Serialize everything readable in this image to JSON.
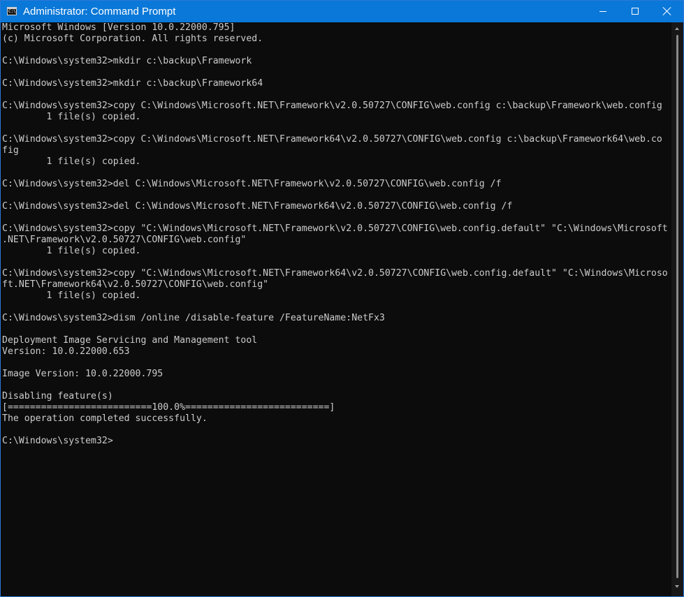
{
  "window": {
    "title": "Administrator: Command Prompt",
    "icon": "cmd-icon",
    "icon_prompt": "C:\\",
    "controls": [
      "minimize-icon",
      "maximize-icon",
      "close-icon"
    ]
  },
  "colors": {
    "titlebar": "#0a78d8",
    "console_bg": "#0c0c0c",
    "console_text": "#cccccc"
  },
  "console": {
    "lines": [
      "Microsoft Windows [Version 10.0.22000.795]",
      "(c) Microsoft Corporation. All rights reserved.",
      "",
      "C:\\Windows\\system32>mkdir c:\\backup\\Framework",
      "",
      "C:\\Windows\\system32>mkdir c:\\backup\\Framework64",
      "",
      "C:\\Windows\\system32>copy C:\\Windows\\Microsoft.NET\\Framework\\v2.0.50727\\CONFIG\\web.config c:\\backup\\Framework\\web.config",
      "        1 file(s) copied.",
      "",
      "C:\\Windows\\system32>copy C:\\Windows\\Microsoft.NET\\Framework64\\v2.0.50727\\CONFIG\\web.config c:\\backup\\Framework64\\web.co",
      "fig",
      "        1 file(s) copied.",
      "",
      "C:\\Windows\\system32>del C:\\Windows\\Microsoft.NET\\Framework\\v2.0.50727\\CONFIG\\web.config /f",
      "",
      "C:\\Windows\\system32>del C:\\Windows\\Microsoft.NET\\Framework64\\v2.0.50727\\CONFIG\\web.config /f",
      "",
      "C:\\Windows\\system32>copy \"C:\\Windows\\Microsoft.NET\\Framework\\v2.0.50727\\CONFIG\\web.config.default\" \"C:\\Windows\\Microsoft",
      ".NET\\Framework\\v2.0.50727\\CONFIG\\web.config\"",
      "        1 file(s) copied.",
      "",
      "C:\\Windows\\system32>copy \"C:\\Windows\\Microsoft.NET\\Framework64\\v2.0.50727\\CONFIG\\web.config.default\" \"C:\\Windows\\Microso",
      "ft.NET\\Framework64\\v2.0.50727\\CONFIG\\web.config\"",
      "        1 file(s) copied.",
      "",
      "C:\\Windows\\system32>dism /online /disable-feature /FeatureName:NetFx3",
      "",
      "Deployment Image Servicing and Management tool",
      "Version: 10.0.22000.653",
      "",
      "Image Version: 10.0.22000.795",
      "",
      "Disabling feature(s)",
      "[==========================100.0%==========================]",
      "The operation completed successfully.",
      "",
      "C:\\Windows\\system32>"
    ]
  }
}
